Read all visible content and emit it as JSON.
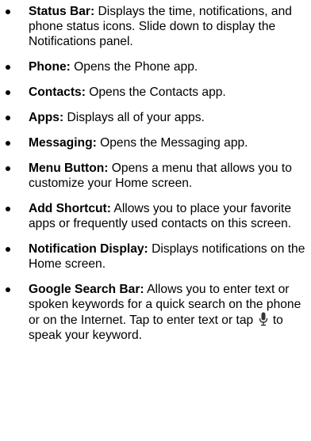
{
  "items": [
    {
      "term": "Status Bar:",
      "desc": " Displays the time, notifications, and phone status icons. Slide down to display the Notifications panel."
    },
    {
      "term": "Phone:",
      "desc": " Opens the Phone app."
    },
    {
      "term": "Contacts:",
      "desc": " Opens the Contacts app."
    },
    {
      "term": "Apps:",
      "desc": " Displays all of your apps."
    },
    {
      "term": "Messaging:",
      "desc": " Opens the Messaging app."
    },
    {
      "term": "Menu Button:",
      "desc": " Opens a menu that allows you to customize your Home screen."
    },
    {
      "term": "Add Shortcut:",
      "desc": " Allows you to place your favorite apps or frequently used contacts on this screen."
    },
    {
      "term": "Notification Display:",
      "desc": " Displays notifications on the Home screen."
    },
    {
      "term": "Google Search Bar:",
      "desc_before": " Allows you to enter text or spoken keywords for a quick search on the phone or on the Internet. Tap to enter text or tap ",
      "icon": "microphone-icon",
      "desc_after": " to speak your keyword."
    }
  ]
}
